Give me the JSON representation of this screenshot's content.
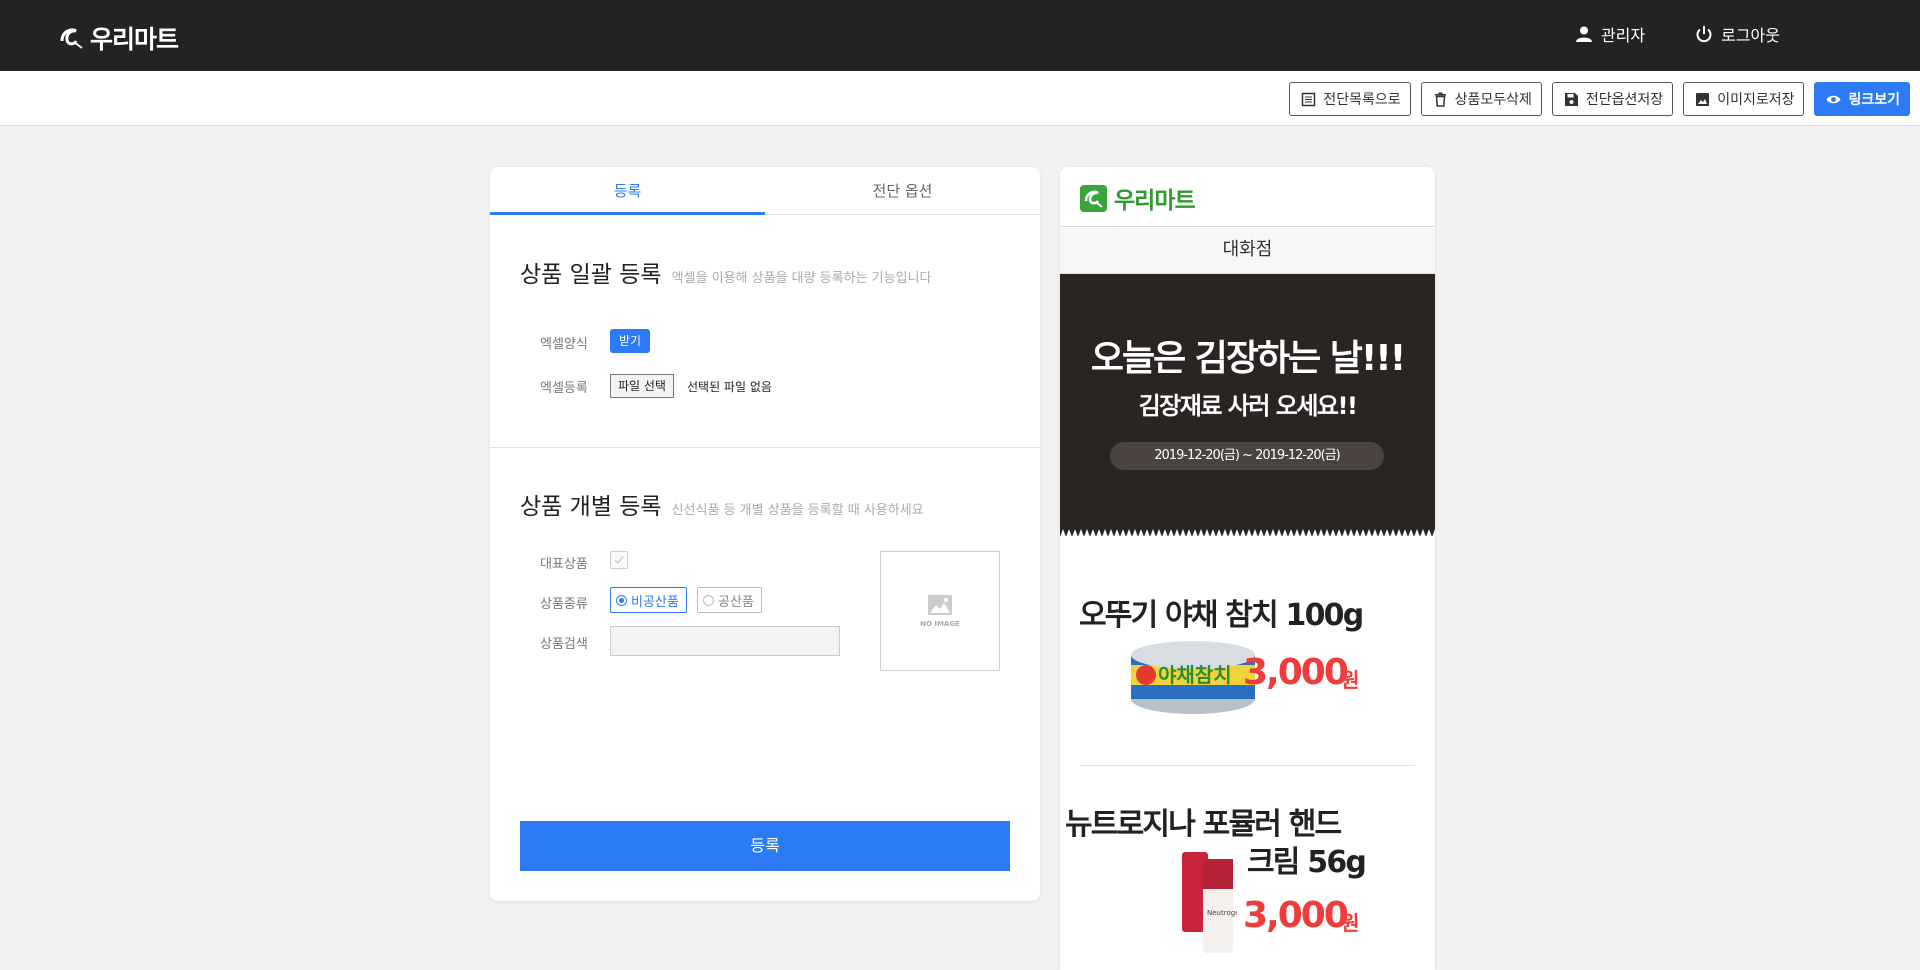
{
  "header": {
    "brand": "우리마트",
    "admin_label": "관리자",
    "logout_label": "로그아웃"
  },
  "toolbar": {
    "list_label": "전단목록으로",
    "delete_all_label": "상품모두삭제",
    "save_options_label": "전단옵션저장",
    "save_image_label": "이미지로저장",
    "view_link_label": "링크보기"
  },
  "tabs": {
    "register": "등록",
    "options": "전단 옵션"
  },
  "bulk": {
    "title": "상품 일괄 등록",
    "desc": "엑셀을 이용해 상품을 대량 등록하는 기능입니다",
    "template_label": "엑셀양식",
    "download_label": "받기",
    "upload_label": "엑셀등록",
    "file_button": "파일 선택",
    "file_status": "선택된 파일 없음"
  },
  "single": {
    "title": "상품 개별 등록",
    "desc": "신선식품 등 개별 상품을 등록할 때 사용하세요",
    "featured_label": "대표상품",
    "type_label": "상품종류",
    "type_options": [
      "비공산품",
      "공산품"
    ],
    "selected_type": "비공산품",
    "search_label": "상품검색",
    "noimage_text": "NO IMAGE",
    "submit_label": "등록"
  },
  "preview": {
    "brand": "우리마트",
    "store": "대화점",
    "banner_title": "오늘은 김장하는 날!!!",
    "banner_sub": "김장재료 사러 오세요!!",
    "banner_dates": "2019-12-20(금) ~ 2019-12-20(금)",
    "products": [
      {
        "name": "오뚜기 야채 참치 100g",
        "price": "3,000",
        "unit": "원"
      },
      {
        "name_line1": "뉴트로지나 포뮬러 핸드",
        "name_line2": "크림 56g",
        "price": "3,000",
        "unit": "원"
      }
    ]
  },
  "colors": {
    "topbar": "#232323",
    "accent": "#2d7bf4",
    "price": "#f03c3c",
    "brand_green": "#2f9a2f",
    "banner": "#2a2523"
  }
}
